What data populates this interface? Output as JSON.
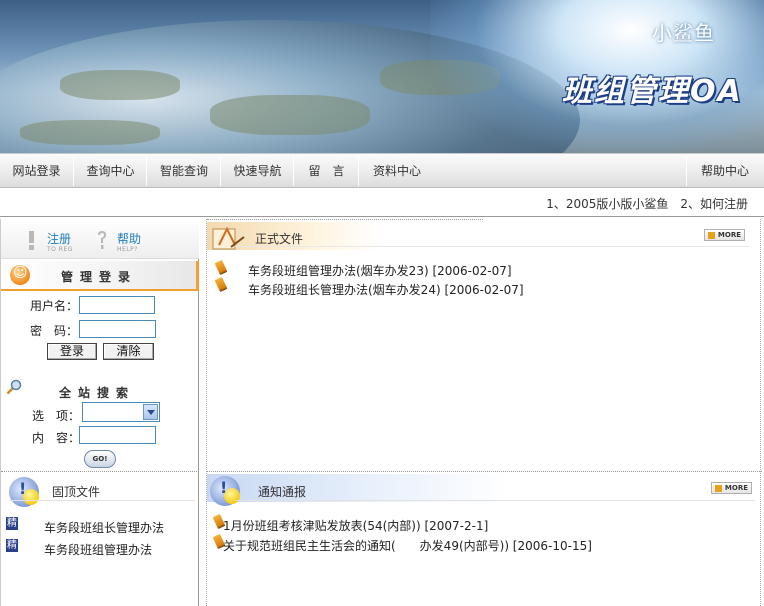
{
  "banner": {
    "small_title": "小鲨鱼",
    "big_title": "班组管理OA"
  },
  "nav": {
    "items": [
      "网站登录",
      "查询中心",
      "智能查询",
      "快速导航",
      "留　言",
      "资料中心"
    ],
    "help": "帮助中心"
  },
  "marquee": {
    "text": "1、2005版小版小鲨鱼　2、如何注册"
  },
  "sidebar": {
    "register": {
      "label": "注册",
      "sub": "TO REG"
    },
    "help": {
      "label": "帮助",
      "sub": "HELP?"
    },
    "login_title": "管理登录",
    "username_label": "用户名：",
    "password_label": "密　码：",
    "login_button": "登录",
    "clear_button": "清除",
    "search_title": "全站搜索",
    "option_label": "选　项：",
    "content_label": "内　容：",
    "go_button": "GO!"
  },
  "pinned": {
    "title": "固顶文件",
    "badge": "精",
    "items": [
      "车务段班组长管理办法",
      "车务段班组管理办法"
    ]
  },
  "official": {
    "title": "正式文件",
    "more": "MORE",
    "items": [
      "车务段班组管理办法(烟车办发23) [2006-02-07]",
      "车务段班组长管理办法(烟车办发24) [2006-02-07]"
    ]
  },
  "notice": {
    "title": "通知通报",
    "more": "MORE",
    "items": [
      "1月份班组考核津贴发放表(54(内部)) [2007-2-1]",
      "关于规范班组民主生活会的通知(　　办发49(内部号)) [2006-10-15]"
    ]
  },
  "colors": {
    "accent": "#f0a030",
    "link": "#1f7fbf",
    "border_blue": "#4a8ab8"
  }
}
